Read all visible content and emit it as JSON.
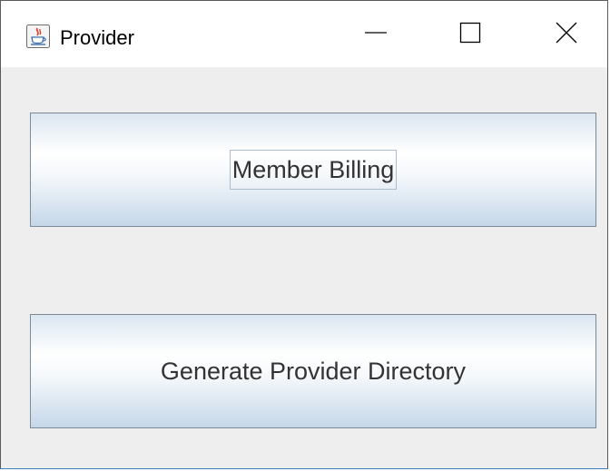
{
  "window": {
    "title": "Provider",
    "icon": "java-cup-icon",
    "controls": {
      "minimize": "minimize-icon",
      "maximize": "maximize-icon",
      "close": "close-icon"
    }
  },
  "buttons": {
    "member_billing": "Member Billing",
    "generate_provider_directory": "Generate Provider Directory"
  },
  "colors": {
    "window_border": "#5a5a5a",
    "window_bottom_accent": "#3c7fc1",
    "content_background": "#eeeeee",
    "button_border": "#7a8a99",
    "button_gradient_top": "#dbe6f1",
    "button_gradient_bottom": "#c5d7e9",
    "focus_border": "#a9bcd0",
    "button_text": "#333333"
  }
}
